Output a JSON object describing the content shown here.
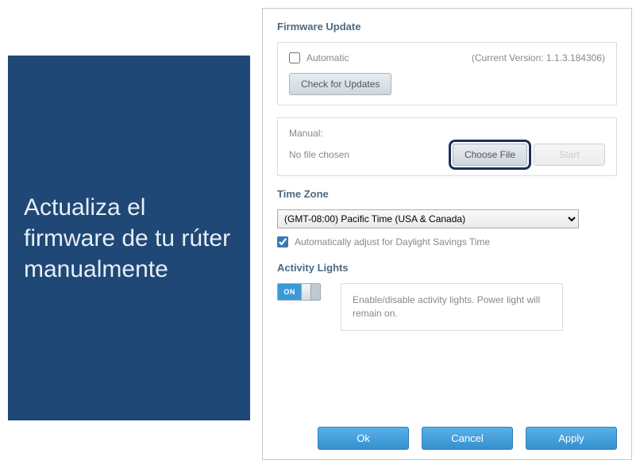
{
  "left_instruction": "Actualiza el firmware de tu rúter manualmente",
  "firmware": {
    "section_title": "Firmware Update",
    "automatic_label": "Automatic",
    "automatic_checked": false,
    "version_text": "(Current Version: 1.1.3.184306)",
    "check_updates_label": "Check for Updates",
    "manual_label": "Manual:",
    "no_file_text": "No file chosen",
    "choose_file_label": "Choose File",
    "start_label": "Start"
  },
  "timezone": {
    "section_title": "Time Zone",
    "selected": "(GMT-08:00) Pacific Time (USA & Canada)",
    "dst_checked": true,
    "dst_label": "Automatically adjust for Daylight Savings Time"
  },
  "activity": {
    "section_title": "Activity Lights",
    "toggle_state": "ON",
    "description": "Enable/disable activity lights. Power light will remain on."
  },
  "buttons": {
    "ok": "Ok",
    "cancel": "Cancel",
    "apply": "Apply"
  }
}
